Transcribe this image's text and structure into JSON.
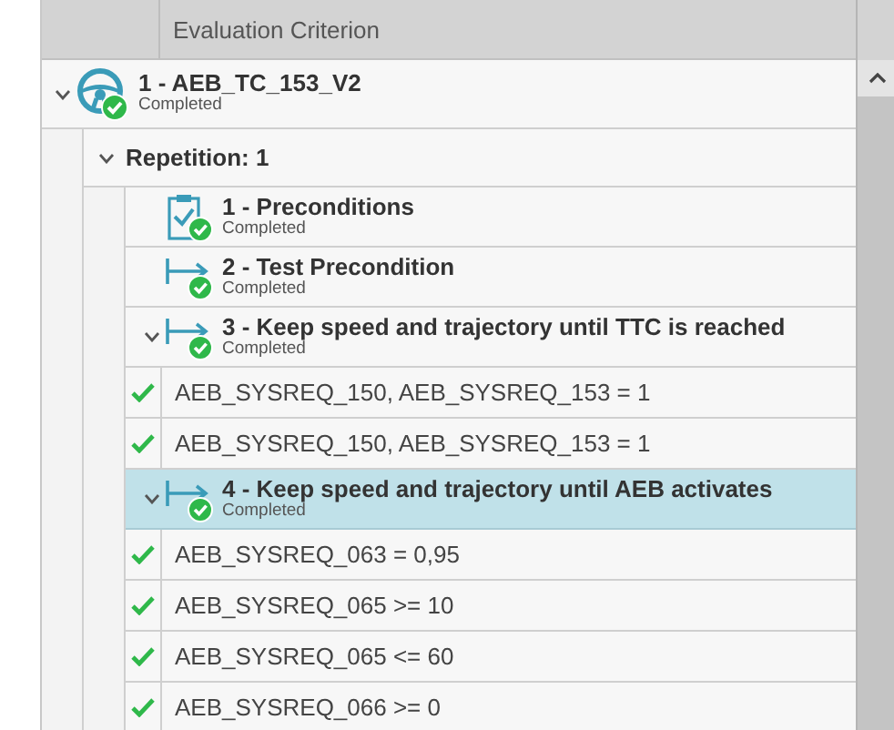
{
  "header": {
    "column_title": "Evaluation Criterion"
  },
  "root": {
    "title": "1 - AEB_TC_153_V2",
    "status": "Completed",
    "expanded": true,
    "repetitions": [
      {
        "label": "Repetition: 1",
        "expanded": true,
        "steps": [
          {
            "kind": "preconditions",
            "title": "1 - Preconditions",
            "status": "Completed",
            "selected": false
          },
          {
            "kind": "action",
            "title": "2 - Test Precondition",
            "status": "Completed",
            "selected": false
          },
          {
            "kind": "action",
            "title": "3 - Keep speed and trajectory until TTC is reached",
            "status": "Completed",
            "selected": false,
            "expanded": true,
            "criteria": [
              {
                "text": "AEB_SYSREQ_150, AEB_SYSREQ_153 = 1",
                "passed": true
              },
              {
                "text": "AEB_SYSREQ_150, AEB_SYSREQ_153 = 1",
                "passed": true
              }
            ]
          },
          {
            "kind": "action",
            "title": "4 - Keep speed and trajectory until AEB activates",
            "status": "Completed",
            "selected": true,
            "expanded": true,
            "criteria": [
              {
                "text": "AEB_SYSREQ_063 = 0,95",
                "passed": true
              },
              {
                "text": "AEB_SYSREQ_065 >= 10",
                "passed": true
              },
              {
                "text": "AEB_SYSREQ_065 <= 60",
                "passed": true
              },
              {
                "text": "AEB_SYSREQ_066 >= 0",
                "passed": true
              }
            ]
          }
        ]
      }
    ]
  }
}
